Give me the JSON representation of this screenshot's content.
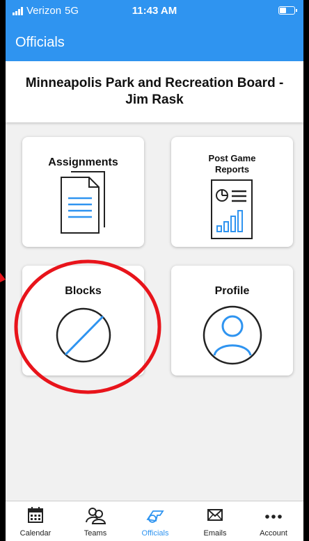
{
  "status_bar": {
    "carrier": "Verizon",
    "network": "5G",
    "time": "11:43 AM"
  },
  "header": {
    "title": "Officials"
  },
  "organization": {
    "name": "Minneapolis Park and Recreation Board - Jim Rask"
  },
  "tiles": [
    {
      "label": "Assignments",
      "icon": "document-icon"
    },
    {
      "label": "Post Game Reports",
      "icon": "report-chart-icon"
    },
    {
      "label": "Blocks",
      "icon": "block-icon"
    },
    {
      "label": "Profile",
      "icon": "profile-icon"
    }
  ],
  "tab_bar": {
    "items": [
      {
        "label": "Calendar",
        "icon": "calendar-icon"
      },
      {
        "label": "Teams",
        "icon": "teams-icon"
      },
      {
        "label": "Officials",
        "icon": "whistle-icon",
        "active": true
      },
      {
        "label": "Emails",
        "icon": "mail-icon"
      },
      {
        "label": "Account",
        "icon": "more-icon"
      }
    ]
  },
  "colors": {
    "accent": "#2f94f0",
    "annotation": "#e8141b",
    "background": "#f1f1f1"
  }
}
